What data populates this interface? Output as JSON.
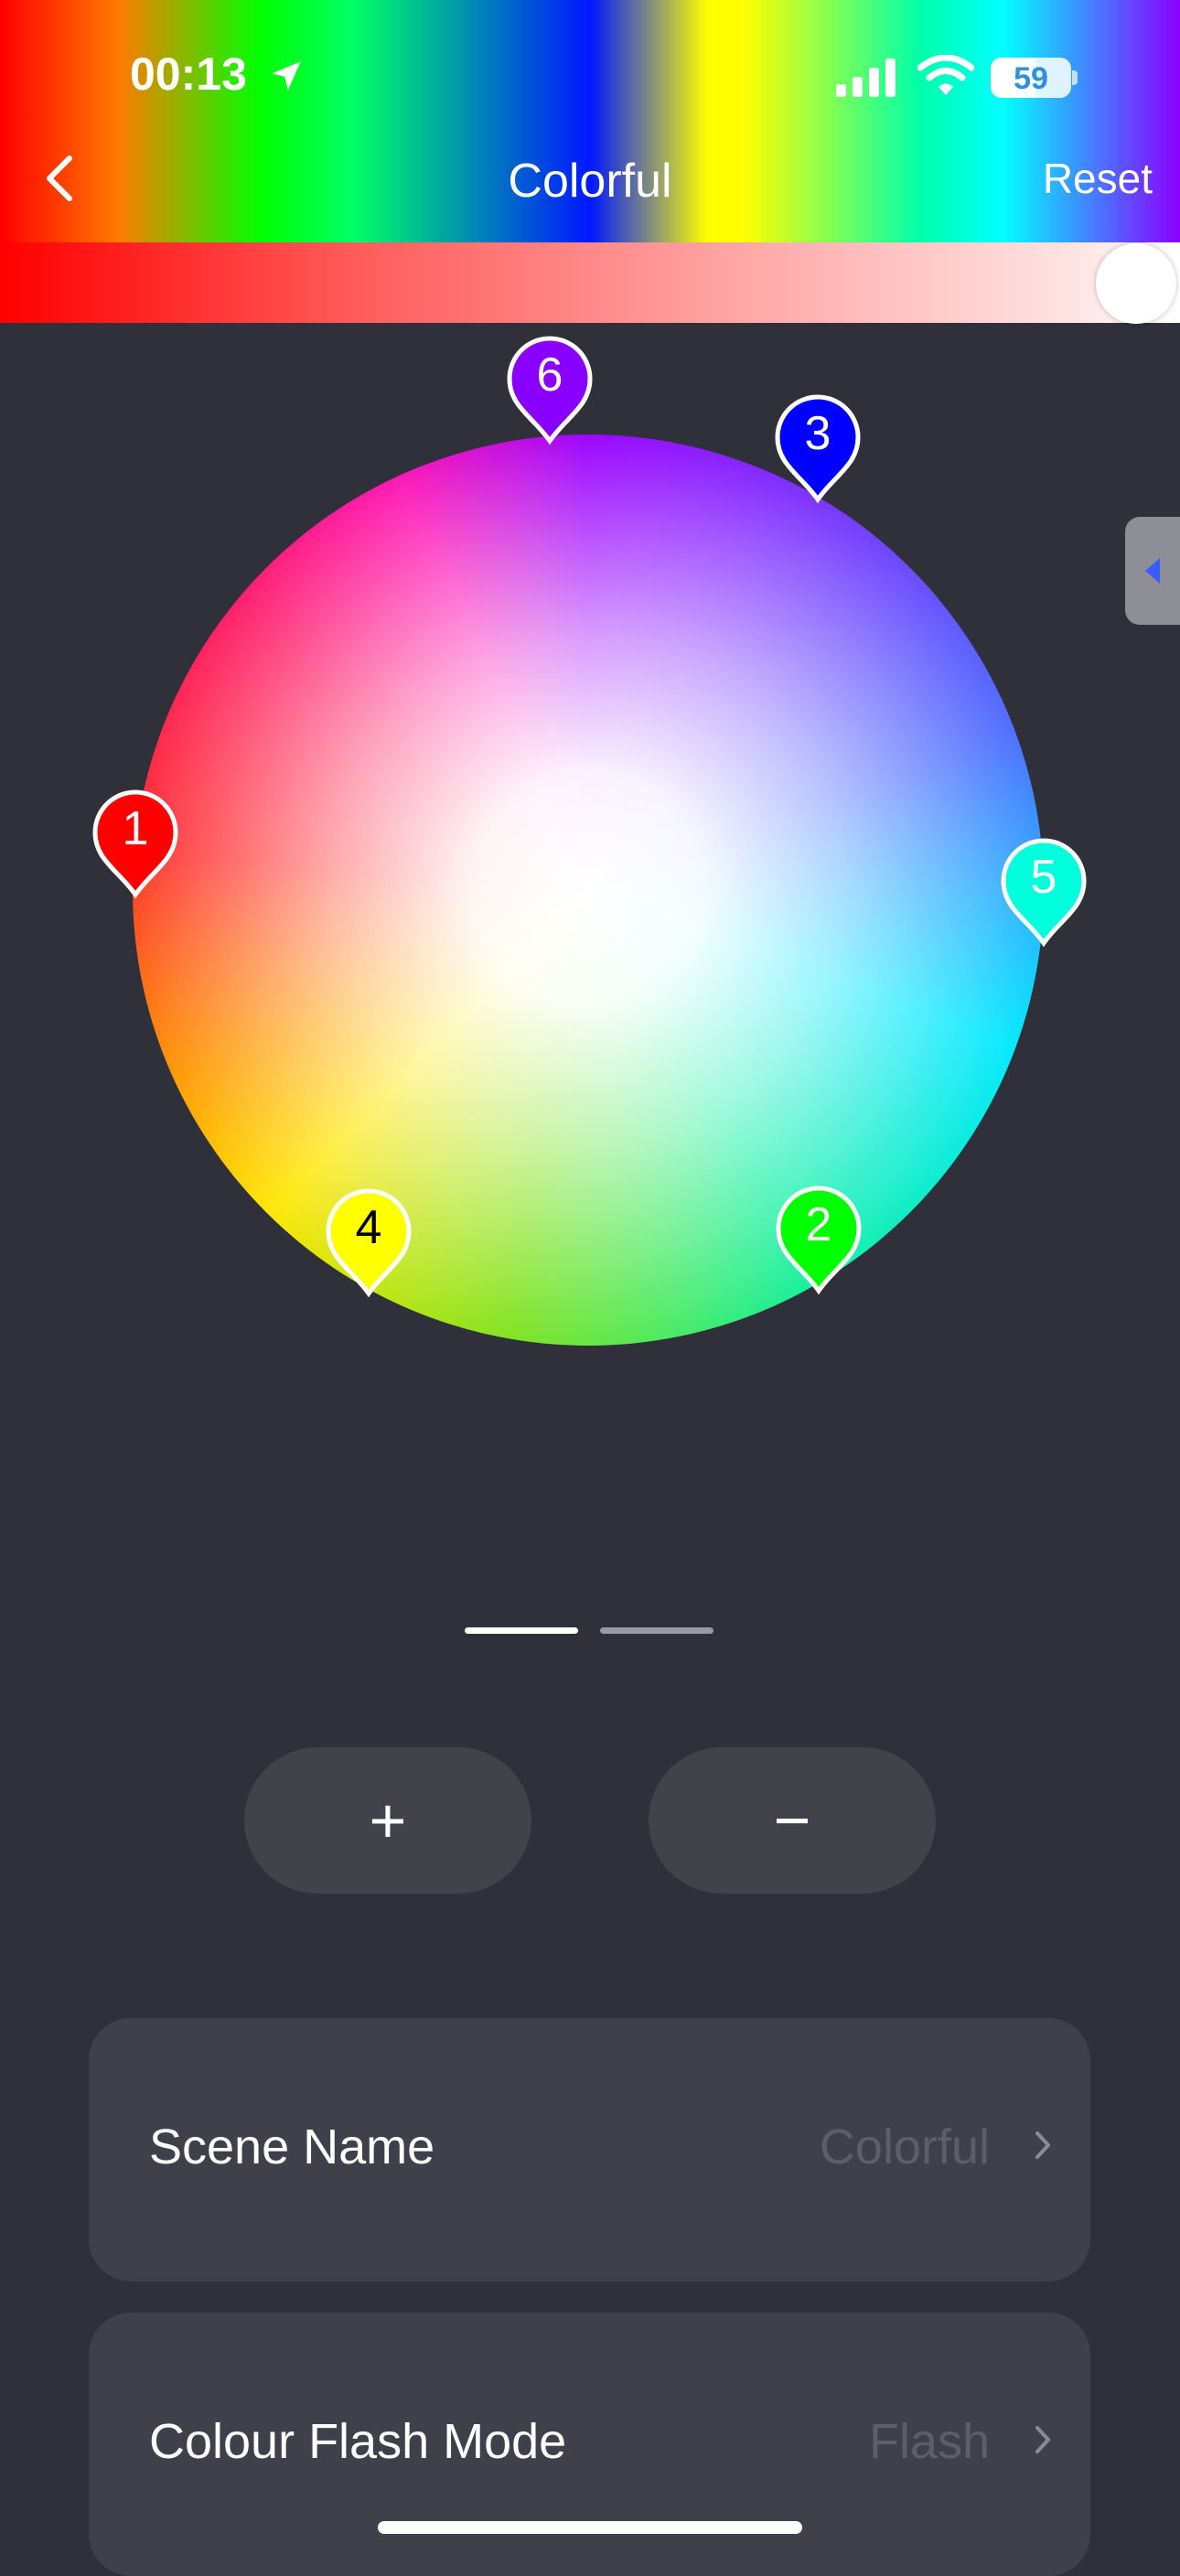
{
  "status_bar": {
    "time": "00:13",
    "battery": "59"
  },
  "header": {
    "title": "Colorful",
    "reset_label": "Reset"
  },
  "brightness": {
    "value_fraction": 0.97
  },
  "color_pins": [
    {
      "label": "1",
      "color": "#ff0000"
    },
    {
      "label": "2",
      "color": "#00ff00"
    },
    {
      "label": "3",
      "color": "#0000ff"
    },
    {
      "label": "4",
      "color": "#ffff00"
    },
    {
      "label": "5",
      "color": "#00ffdd"
    },
    {
      "label": "6",
      "color": "#8a00ff"
    }
  ],
  "controls": {
    "add_label": "+",
    "remove_label": "−"
  },
  "pager": {
    "pages": 2,
    "active": 1
  },
  "settings": {
    "scene_name": {
      "label": "Scene Name",
      "value": "Colorful"
    },
    "flash_mode": {
      "label": "Colour Flash Mode",
      "value": "Flash"
    }
  },
  "colors": {
    "background": "#2f3039",
    "card": "#3f4049"
  }
}
